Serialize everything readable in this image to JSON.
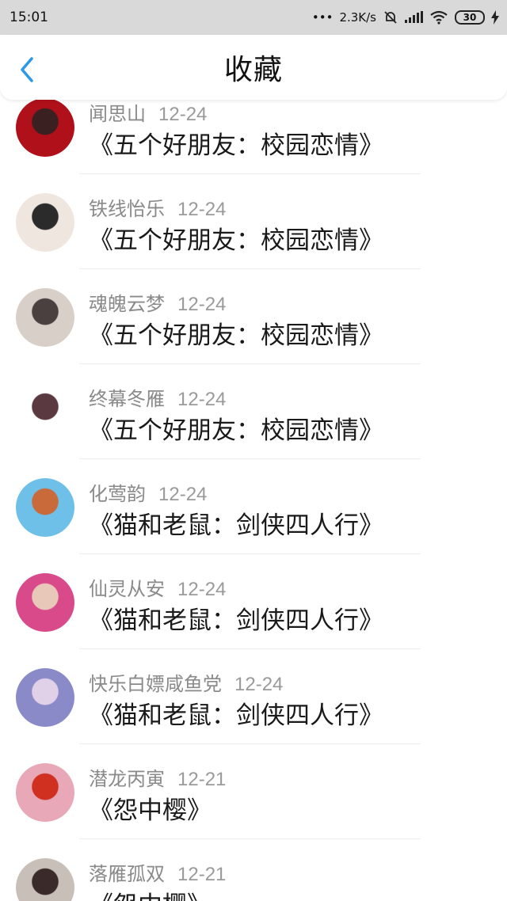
{
  "status_bar": {
    "time": "15:01",
    "dots": "•••",
    "speed": "2.3K/s",
    "battery": "30"
  },
  "header": {
    "title": "收藏"
  },
  "items": [
    {
      "user": "闻思山",
      "date": "12-24",
      "work": "《五个好朋友：校园恋情》",
      "avatar_colors": [
        "#b0101a",
        "#3a2020"
      ]
    },
    {
      "user": "铁线怡乐",
      "date": "12-24",
      "work": "《五个好朋友：校园恋情》",
      "avatar_colors": [
        "#f0e6e0",
        "#2b2b2b"
      ]
    },
    {
      "user": "魂魄云梦",
      "date": "12-24",
      "work": "《五个好朋友：校园恋情》",
      "avatar_colors": [
        "#d8d0c8",
        "#4a4040"
      ]
    },
    {
      "user": "终幕冬雁",
      "date": "12-24",
      "work": "《五个好朋友：校园恋情》",
      "avatar_colors": [
        "#ffffff",
        "#5a3a40"
      ]
    },
    {
      "user": "化莺韵",
      "date": "12-24",
      "work": "《猫和老鼠：剑侠四人行》",
      "avatar_colors": [
        "#6ec0e8",
        "#c86a3a"
      ]
    },
    {
      "user": "仙灵从安",
      "date": "12-24",
      "work": "《猫和老鼠：剑侠四人行》",
      "avatar_colors": [
        "#d84a8a",
        "#e8c8b8"
      ]
    },
    {
      "user": "快乐白嫖咸鱼党",
      "date": "12-24",
      "work": "《猫和老鼠：剑侠四人行》",
      "avatar_colors": [
        "#8a8ac8",
        "#e0d0e8"
      ]
    },
    {
      "user": "潜龙丙寅",
      "date": "12-21",
      "work": "《怨中樱》",
      "avatar_colors": [
        "#e8a8b8",
        "#d03020"
      ]
    },
    {
      "user": "落雁孤双",
      "date": "12-21",
      "work": "《怨中樱》",
      "avatar_colors": [
        "#c8c0b8",
        "#3a2a2a"
      ]
    }
  ],
  "accent_color": "#2a9ae8"
}
